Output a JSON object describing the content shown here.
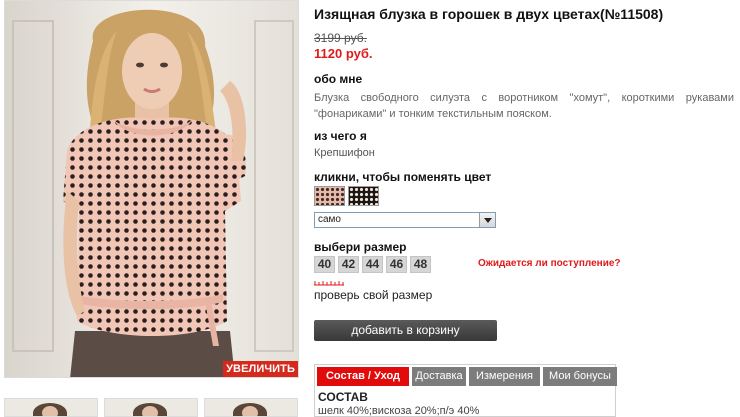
{
  "product": {
    "title": "Изящная блузка в горошек в двух цветах(№11508)",
    "old_price": "3199 руб.",
    "new_price": "1120 руб."
  },
  "photo": {
    "zoom_label": "УВЕЛИЧИТЬ",
    "thumbnail_count": 3
  },
  "about": {
    "heading": "обо мне",
    "text": "Блузка свободного силуэта с воротником \"хомут\", короткими рукавами \"фонариками\" и тонким текстильным пояском."
  },
  "material": {
    "heading": "из чего я",
    "value": "Крепшифон"
  },
  "color": {
    "heading": "кликни, чтобы поменять цвет",
    "swatches": [
      {
        "name": "pink-polka-dot",
        "color": "#e8b8a8"
      },
      {
        "name": "black-polka-dot",
        "color": "#1b1613"
      }
    ],
    "select_value": "само"
  },
  "size": {
    "heading": "выбери размер",
    "options": [
      "40",
      "42",
      "44",
      "46",
      "48"
    ],
    "waiting_link": "Ожидается ли поступление?",
    "check_link": "проверь свой размер"
  },
  "cart": {
    "add_label": "добавить в корзину"
  },
  "tabs": {
    "items": [
      {
        "label": "Состав / Уход",
        "active": true
      },
      {
        "label": "Доставка",
        "active": false
      },
      {
        "label": "Измерения",
        "active": false
      },
      {
        "label": "Мои бонусы",
        "active": false
      }
    ],
    "content_heading": "СОСТАВ",
    "content_text": "шелк 40%;вискоза 20%;п/э 40%"
  },
  "colors": {
    "accent_red": "#e01a1a",
    "tab_active": "#e20b0b",
    "tab_inactive": "#7c7c7c",
    "button_dark": "#3f3f3f"
  }
}
